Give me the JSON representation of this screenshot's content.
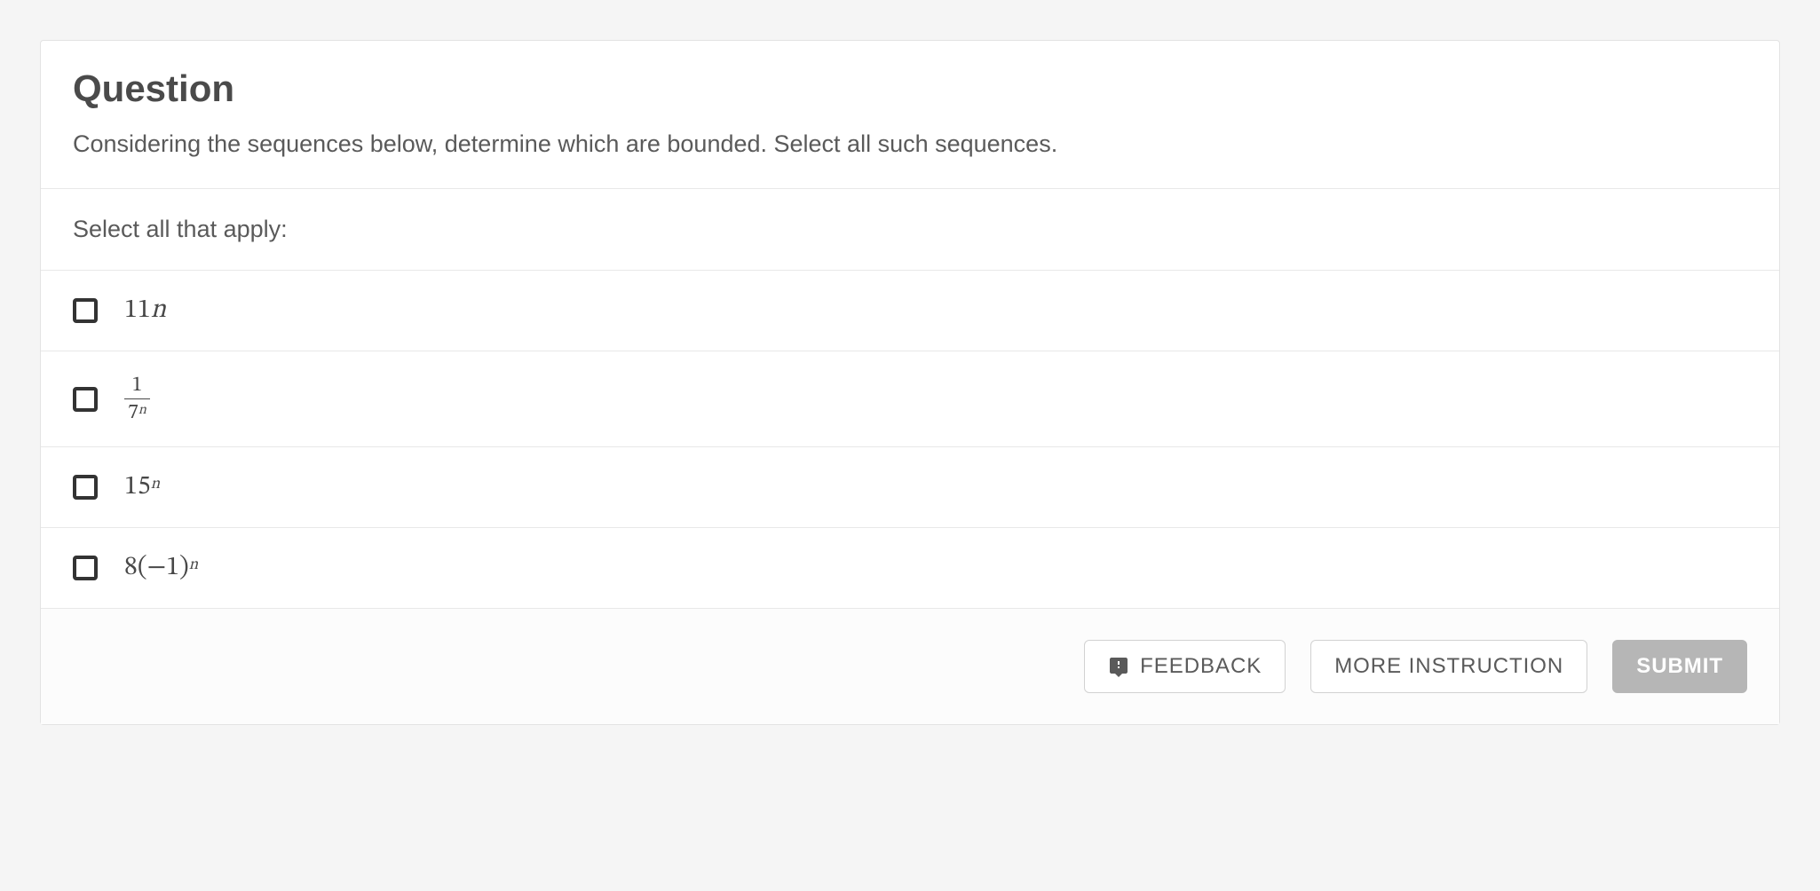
{
  "question": {
    "title": "Question",
    "prompt": "Considering the sequences below, determine which are bounded. Select all such sequences.",
    "instruction": "Select all that apply:",
    "options": [
      {
        "expression_plain": "11n"
      },
      {
        "expression_plain": "1 / 7^n"
      },
      {
        "expression_plain": "15^n"
      },
      {
        "expression_plain": "8(-1)^n"
      }
    ]
  },
  "footer": {
    "feedback_label": "FEEDBACK",
    "more_instruction_label": "MORE INSTRUCTION",
    "submit_label": "SUBMIT"
  },
  "icons": {
    "feedback": "feedback-icon"
  }
}
